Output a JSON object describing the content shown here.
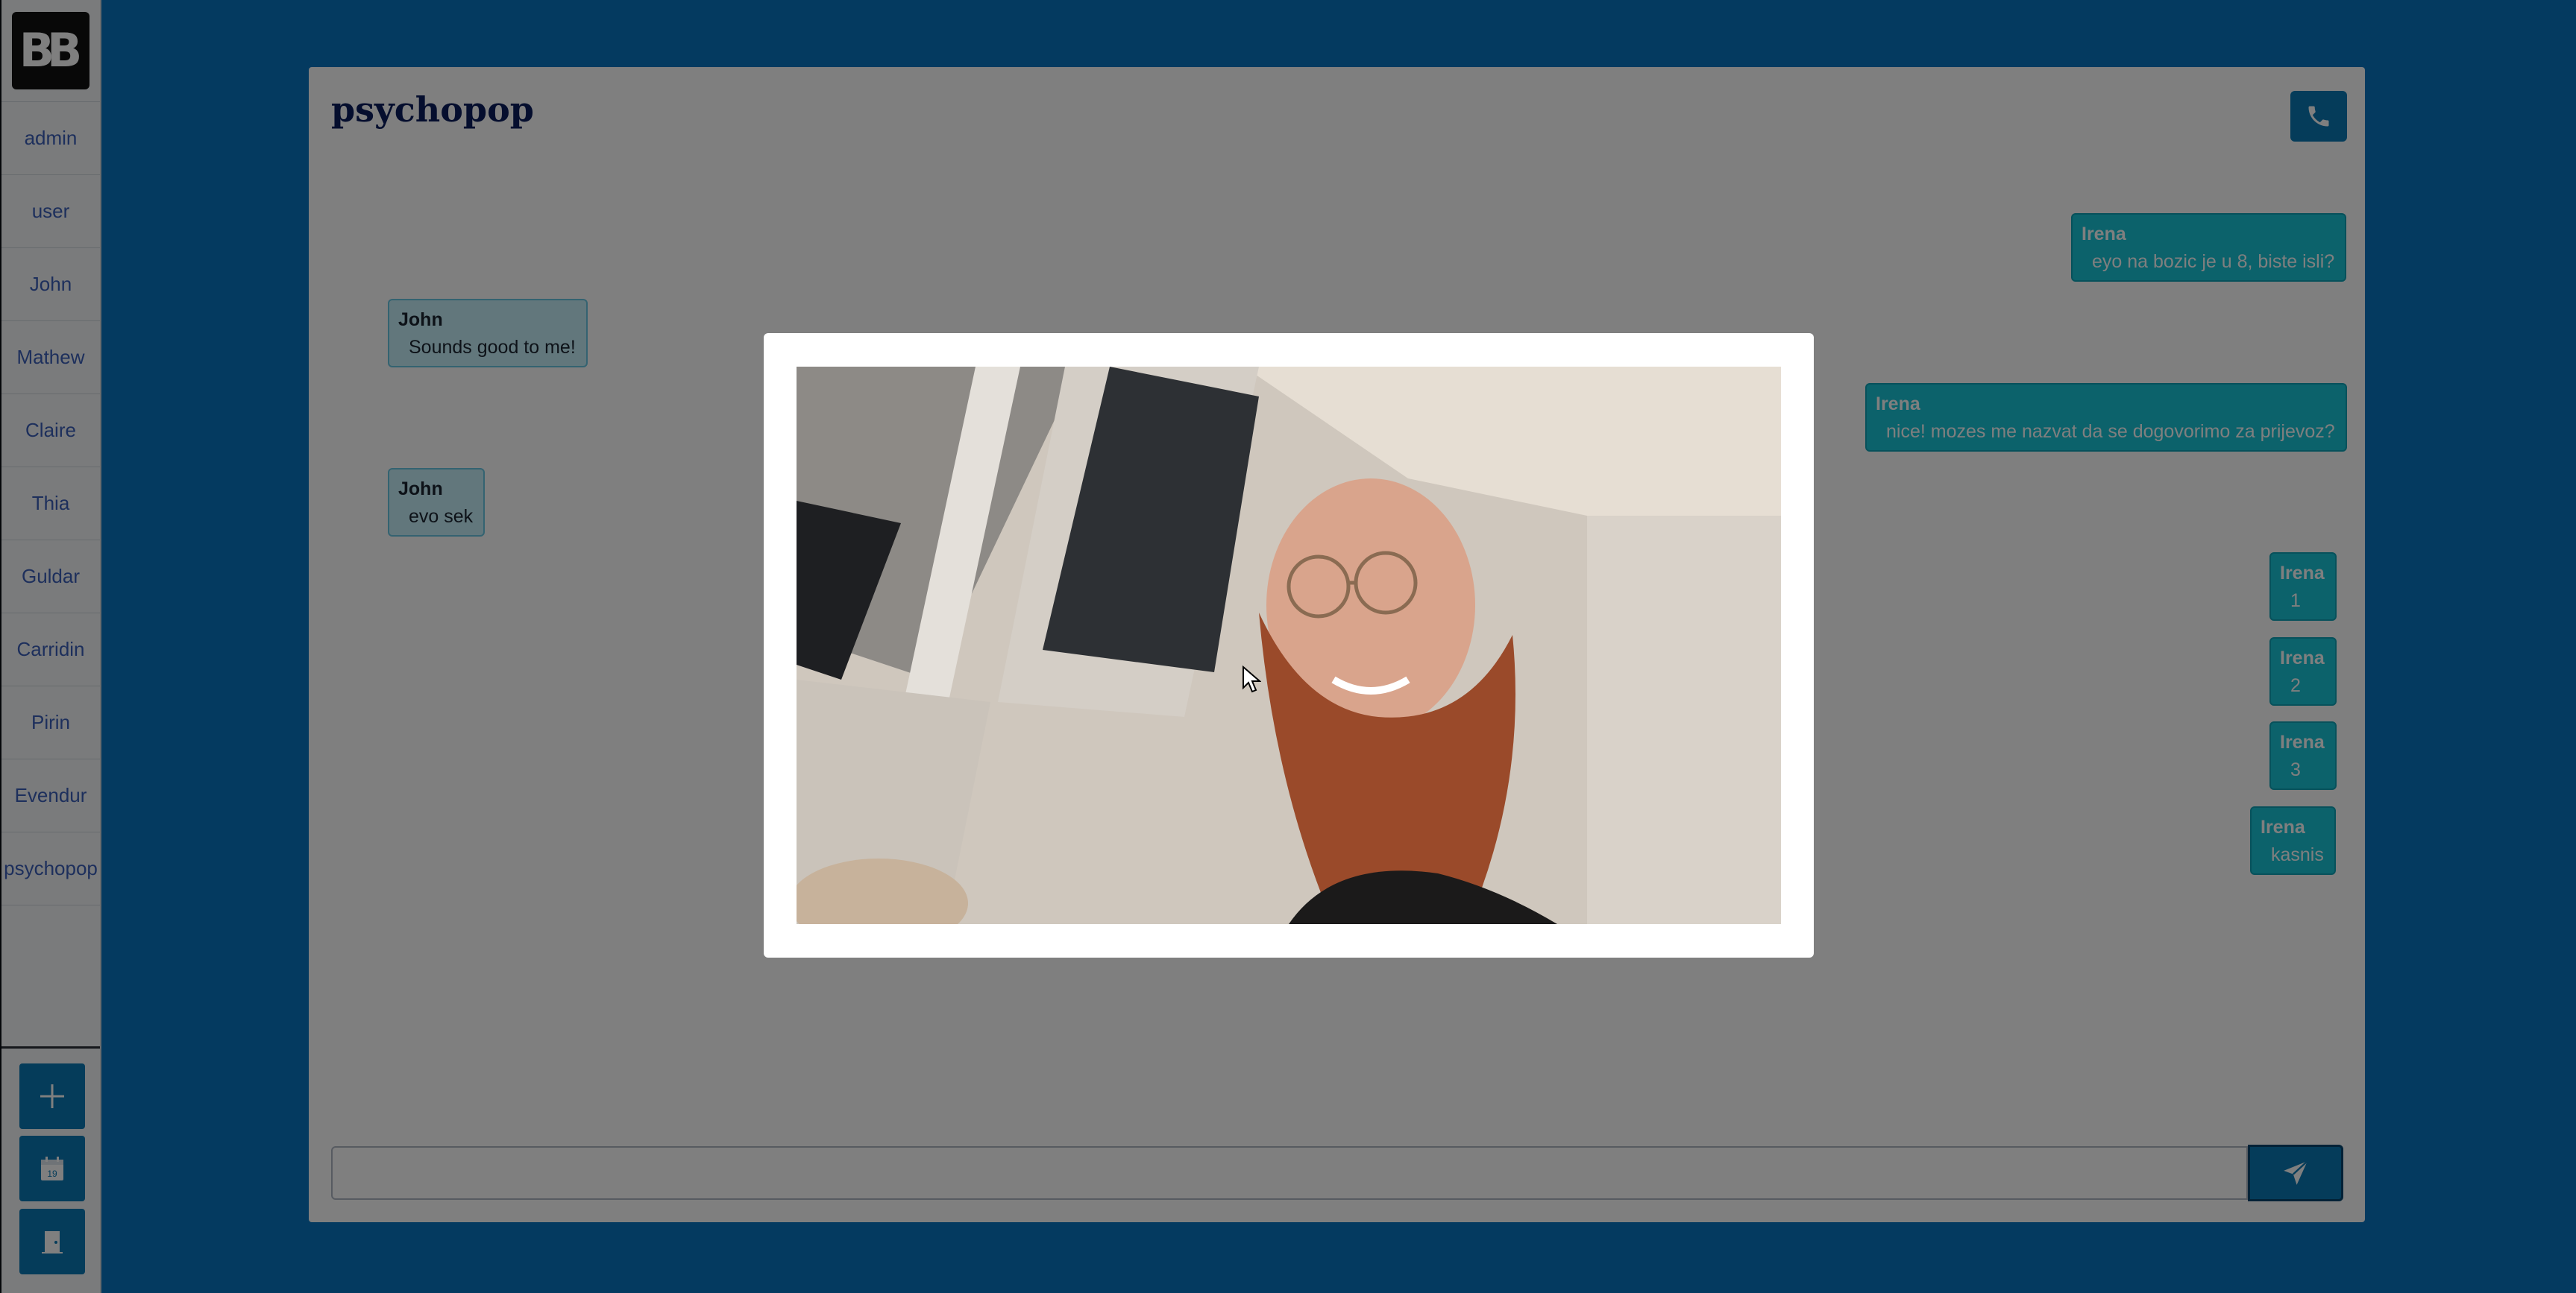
{
  "sidebar": {
    "logo_text": "BB",
    "users": [
      "admin",
      "user",
      "John",
      "Mathew",
      "Claire",
      "Thia",
      "Guldar",
      "Carridin",
      "Pirin",
      "Evendur",
      "psychopop"
    ],
    "actions": [
      {
        "icon": "plus-icon"
      },
      {
        "icon": "calendar-icon",
        "label": "19"
      },
      {
        "icon": "door-exit-icon"
      }
    ]
  },
  "chat": {
    "title": "psychopop",
    "call_icon": "phone-icon",
    "messages": [
      {
        "sender": "Irena",
        "text": "eyo na bozic je u 8, biste isli?",
        "direction": "outgoing"
      },
      {
        "sender": "John",
        "text": "Sounds good to me!",
        "direction": "incoming"
      },
      {
        "sender": "Irena",
        "text": "nice! mozes me nazvat da se dogovorimo za prijevoz?",
        "direction": "outgoing"
      },
      {
        "sender": "John",
        "text": "evo sek",
        "direction": "incoming"
      },
      {
        "sender": "Irena",
        "text": "1",
        "direction": "outgoing"
      },
      {
        "sender": "Irena",
        "text": "2",
        "direction": "outgoing"
      },
      {
        "sender": "Irena",
        "text": "3",
        "direction": "outgoing"
      },
      {
        "sender": "Irena",
        "text": "kasnis",
        "direction": "outgoing"
      }
    ],
    "composer": {
      "value": "",
      "placeholder": ""
    },
    "send_icon": "paper-plane-icon"
  },
  "video_modal": {
    "content": "camera video feed"
  },
  "colors": {
    "accent": "#0b78b4",
    "page_background": "#0874c0",
    "outgoing_bubble": "#18c4d6",
    "incoming_bubble": "#c5eef8",
    "title_text": "#0b1d5c"
  }
}
